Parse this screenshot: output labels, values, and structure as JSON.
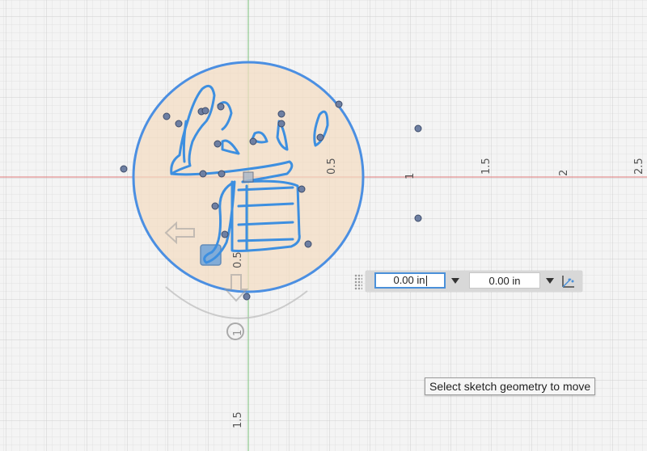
{
  "axis_labels": {
    "x_pos": [
      "0.5",
      "1",
      "1.5",
      "2",
      "2.5"
    ],
    "y_neg": [
      "0.5",
      "1",
      "1.5"
    ]
  },
  "move_toolbar": {
    "x_value": "0.00 in",
    "y_value": "0.00 in"
  },
  "tooltip": "Select sketch geometry to move",
  "icons": [
    "arrow-left-icon",
    "arrow-down-icon",
    "triad-move-icon",
    "dropdown-arrow-icon",
    "grip-icon"
  ],
  "colors": {
    "background": "#f4f4f4",
    "grid_minor": "#e2e2e2",
    "grid_major": "#cfcfcf",
    "x_axis": "#e07a7a",
    "y_axis": "#7ac27a",
    "sketch_line": "#3d8fe0",
    "profile_fill": "#f3dcc0",
    "point": "#6e7fa2"
  }
}
